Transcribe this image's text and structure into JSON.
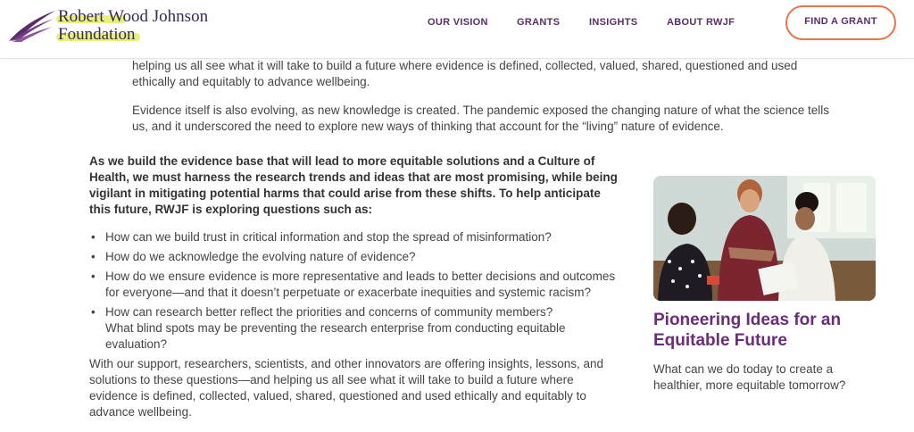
{
  "header": {
    "logo_line1": "Robert Wood Johnson",
    "logo_line2": "Foundation",
    "nav": [
      "OUR VISION",
      "GRANTS",
      "INSIGHTS",
      "ABOUT RWJF"
    ],
    "cta_label": "FIND A GRANT"
  },
  "intro": {
    "p1": "helping us all see what it will take to build a future where evidence is defined, collected, valued, shared, questioned and used ethically and equitably to advance wellbeing.",
    "p2": "Evidence itself is also evolving, as new knowledge is created. The pandemic exposed the changing nature of what the science tells us, and it underscored the need to explore new ways of thinking that account for the “living” nature of evidence."
  },
  "main": {
    "lead": "As we build the evidence base that will lead to more equitable solutions and a Culture of Health, we must harness the research trends and ideas that are most promising, while being vigilant in mitigating potential harms that could arise from these shifts. To help anticipate this future, RWJF is exploring questions such as:",
    "questions": [
      "How can we build trust in critical information and stop the spread of misinformation?",
      "How do we acknowledge the evolving nature of evidence?",
      "How do we ensure evidence is more representative and leads to better decisions and outcomes for everyone—and that it doesn’t perpetuate or exacerbate inequities and systemic racism?",
      "How can research better reflect the priorities and concerns of community members?",
      "What blind spots may be preventing the research enterprise from conducting equitable evaluation?"
    ],
    "closing": "With our support, researchers, scientists, and other innovators are offering insights, lessons, and solutions to these questions—and helping us all see what it will take to build a future where evidence is defined, collected, valued, shared, questioned and used ethically and equitably to advance wellbeing."
  },
  "card": {
    "title": "Pioneering Ideas for an Equitable Future",
    "subtitle": "What can we do today to create a healthier, more equitable tomorrow?"
  },
  "colors": {
    "brand_purple": "#5a2d6a",
    "title_purple": "#6b2c7c",
    "cta_orange": "#e8764a",
    "highlight": "#e7f27e"
  },
  "icons": {
    "logo": "rwjf-wing-logo",
    "bullet": "bullet-dot"
  }
}
